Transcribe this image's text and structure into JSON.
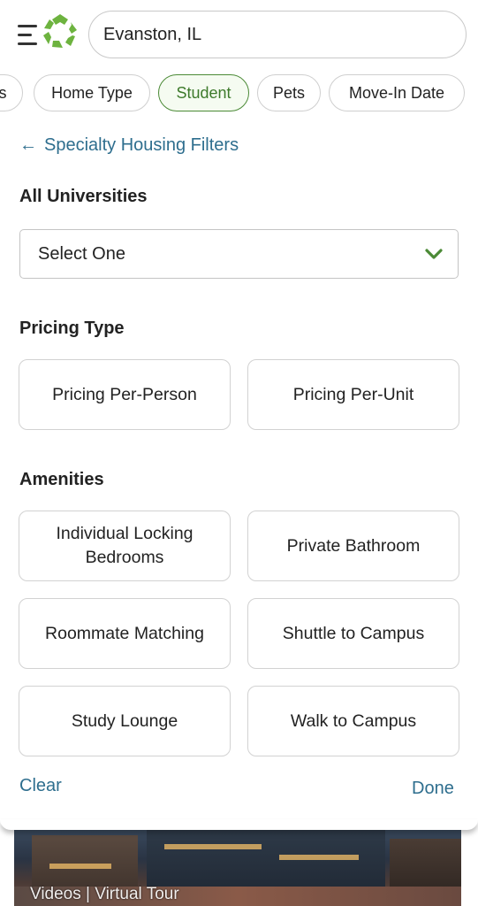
{
  "header": {
    "search": {
      "value": "Evanston, IL",
      "placeholder": ""
    }
  },
  "chips": [
    {
      "label": "ns",
      "active": false
    },
    {
      "label": "Home Type",
      "active": false
    },
    {
      "label": "Student",
      "active": true
    },
    {
      "label": "Pets",
      "active": false
    },
    {
      "label": "Move-In Date",
      "active": false
    }
  ],
  "filters": {
    "back_label": "Specialty Housing Filters",
    "universities": {
      "title": "All Universities",
      "selected": "Select One"
    },
    "pricing_type": {
      "title": "Pricing Type",
      "options": [
        "Pricing Per-Person",
        "Pricing Per-Unit"
      ]
    },
    "amenities": {
      "title": "Amenities",
      "options": [
        "Individual Locking Bedrooms",
        "Private Bathroom",
        "Roommate Matching",
        "Shuttle to Campus",
        "Study Lounge",
        "Walk to Campus"
      ]
    },
    "clear_label": "Clear",
    "done_label": "Done"
  },
  "listing_preview": {
    "media_text": "Videos | Virtual Tour"
  },
  "colors": {
    "accent_green": "#4b8a36",
    "link_blue": "#2e6e8e"
  }
}
